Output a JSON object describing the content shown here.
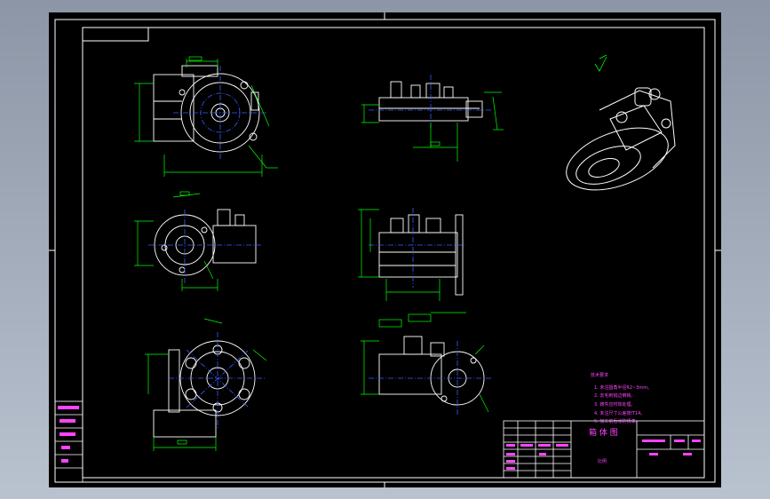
{
  "colors": {
    "background": "#000000",
    "sheet_frame": "#ffffff",
    "dimension": "#00ff00",
    "centerline": "#3b5bff",
    "part_line": "#ffffff",
    "note_text": "#ff44ff"
  },
  "icons": {
    "sheet": "drawing-sheet-icon",
    "iso_view": "isometric-part-icon",
    "roughness": "surface-roughness-icon"
  },
  "title_block": {
    "drawing_title": "箱 体 图",
    "scale_label": "比例"
  },
  "technical_notes": {
    "heading": "技术要求",
    "lines": [
      "1. 未注圆角半径R2~3mm。",
      "2. 去毛刺锐边倒钝。",
      "3. 铸件应时效处理。",
      "4. 未注尺寸公差按IT14。",
      "5. 加工前后涂防锈漆。"
    ]
  }
}
